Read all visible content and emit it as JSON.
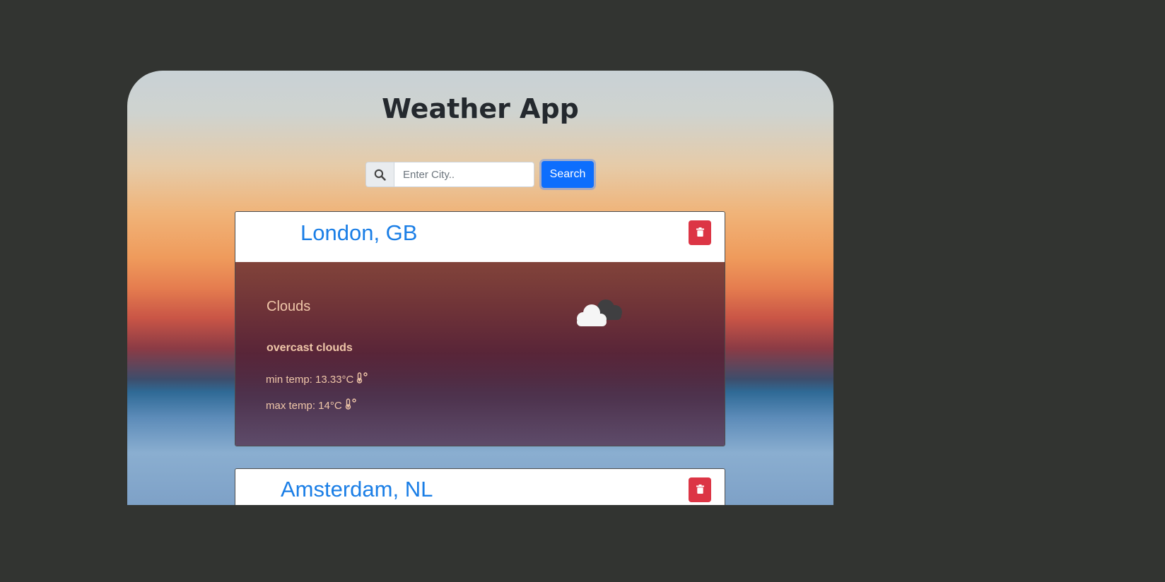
{
  "app": {
    "title": "Weather App"
  },
  "search": {
    "placeholder": "Enter City..",
    "button_label": "Search"
  },
  "cities": [
    {
      "name": "London, GB",
      "weather_main": "Clouds",
      "description": "overcast clouds",
      "min_temp": "min temp: 13.33°C",
      "max_temp": "max temp: 14°C",
      "icon": "clouds-icon"
    },
    {
      "name": "Amsterdam, NL"
    }
  ],
  "colors": {
    "background": "#323431",
    "title": "#1a7ee6",
    "delete": "#dc3545",
    "search_button": "#0d6efd",
    "detail_text": "#f0c7a9"
  }
}
